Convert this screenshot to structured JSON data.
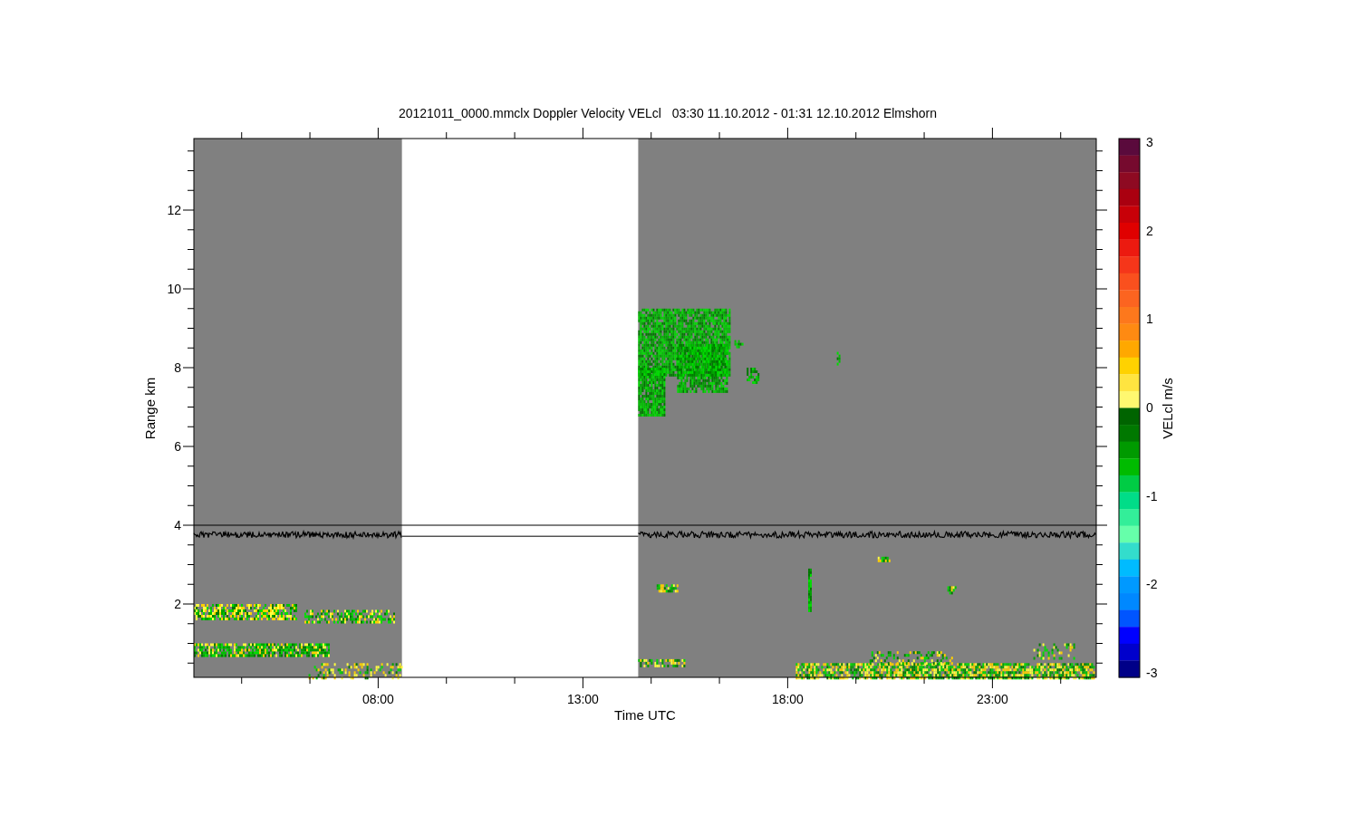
{
  "plot": {
    "title": "20121011_0000.mmclx Doppler Velocity VELcl   03:30 11.10.2012 - 01:31 12.10.2012 Elmshorn",
    "xlabel": "Time UTC",
    "ylabel": "Range km",
    "xticks": [
      "08:00",
      "13:00",
      "18:00",
      "23:00"
    ],
    "yticks": [
      "12",
      "10",
      "8",
      "6",
      "4",
      "2"
    ]
  },
  "colorbar": {
    "label": "VELcl m/s",
    "ticks": [
      "3",
      "2",
      "1",
      "0",
      "-1",
      "-2",
      "-3"
    ],
    "segments": [
      {
        "color": "#5a0a3c"
      },
      {
        "color": "#760a2e"
      },
      {
        "color": "#8e0a22"
      },
      {
        "color": "#aa0010"
      },
      {
        "color": "#c80008"
      },
      {
        "color": "#e00000"
      },
      {
        "color": "#ec1a10"
      },
      {
        "color": "#f5361a"
      },
      {
        "color": "#fa501e"
      },
      {
        "color": "#fc6420"
      },
      {
        "color": "#fd781c"
      },
      {
        "color": "#fe8a12"
      },
      {
        "color": "#ffa800"
      },
      {
        "color": "#ffd200"
      },
      {
        "color": "#ffe440"
      },
      {
        "color": "#fff870"
      },
      {
        "color": "#006400"
      },
      {
        "color": "#007800"
      },
      {
        "color": "#009a00"
      },
      {
        "color": "#00bb00"
      },
      {
        "color": "#00cc44"
      },
      {
        "color": "#00dd88"
      },
      {
        "color": "#33ee99"
      },
      {
        "color": "#66ffaa"
      },
      {
        "color": "#33ddcc"
      },
      {
        "color": "#00bbff"
      },
      {
        "color": "#0099ff"
      },
      {
        "color": "#0088ff"
      },
      {
        "color": "#0055ff"
      },
      {
        "color": "#0000ff"
      },
      {
        "color": "#0000cc"
      },
      {
        "color": "#000088"
      }
    ]
  }
}
